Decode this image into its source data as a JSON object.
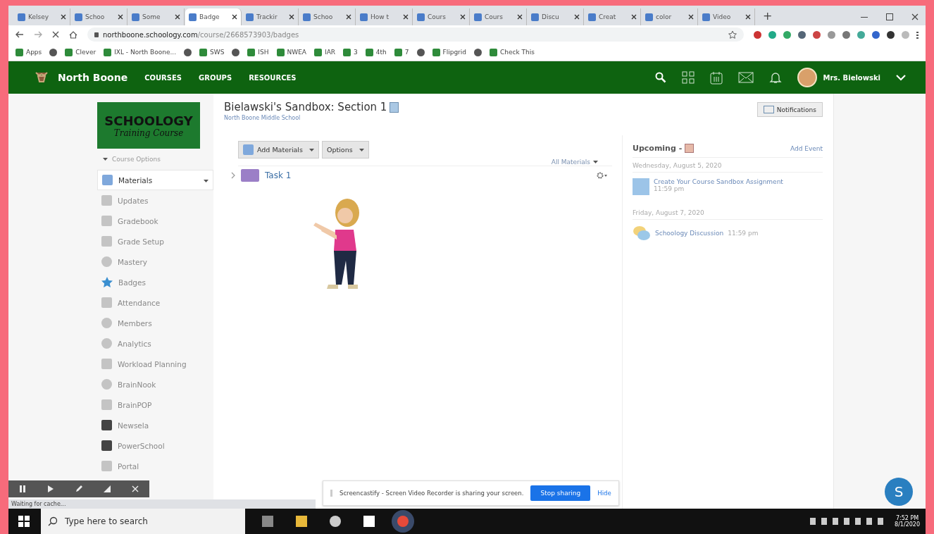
{
  "browser": {
    "tabs": [
      {
        "label": "Kelsey",
        "selected": false
      },
      {
        "label": "Schoo",
        "selected": false
      },
      {
        "label": "Some",
        "selected": false
      },
      {
        "label": "Badge",
        "selected": true
      },
      {
        "label": "Trackir",
        "selected": false
      },
      {
        "label": "Schoo",
        "selected": false
      },
      {
        "label": "How t",
        "selected": false
      },
      {
        "label": "Cours",
        "selected": false
      },
      {
        "label": "Cours",
        "selected": false
      },
      {
        "label": "Discu",
        "selected": false
      },
      {
        "label": "Creat",
        "selected": false
      },
      {
        "label": "color",
        "selected": false
      },
      {
        "label": "Video",
        "selected": false
      }
    ],
    "new_tab": "+",
    "url_host": "northboone.schoology.com",
    "url_path": "/course/2668573903/badges",
    "bookmarks": [
      {
        "kind": "link",
        "label": "Apps"
      },
      {
        "kind": "icon"
      },
      {
        "kind": "link",
        "label": "Clever"
      },
      {
        "kind": "link",
        "label": "IXL - North Boone..."
      },
      {
        "kind": "icon"
      },
      {
        "kind": "link",
        "label": "SWS"
      },
      {
        "kind": "icon"
      },
      {
        "kind": "link",
        "label": "ISH"
      },
      {
        "kind": "link",
        "label": "NWEA"
      },
      {
        "kind": "link",
        "label": "IAR"
      },
      {
        "kind": "link",
        "label": "3"
      },
      {
        "kind": "link",
        "label": "4th"
      },
      {
        "kind": "link",
        "label": "7"
      },
      {
        "kind": "icon"
      },
      {
        "kind": "link",
        "label": "Flipgrid"
      },
      {
        "kind": "icon"
      },
      {
        "kind": "link",
        "label": "Check This"
      }
    ]
  },
  "header": {
    "brand": "North Boone",
    "nav": [
      "COURSES",
      "GROUPS",
      "RESOURCES"
    ],
    "user": "Mrs. Bielowski"
  },
  "course": {
    "logo_title": "SCHOOLOGY",
    "logo_subtitle": "Training Course",
    "options": "Course Options",
    "title": "Bielawski's Sandbox: Section 1",
    "school": "North Boone Middle School",
    "notifications": "Notifications"
  },
  "sidebar": {
    "items": [
      {
        "label": "Materials",
        "kind": "folder",
        "selected": true
      },
      {
        "label": "Updates",
        "kind": "tile",
        "selected": false
      },
      {
        "label": "Gradebook",
        "kind": "tile",
        "selected": false
      },
      {
        "label": "Grade Setup",
        "kind": "tile",
        "selected": false
      },
      {
        "label": "Mastery",
        "kind": "round",
        "selected": false
      },
      {
        "label": "Badges",
        "kind": "star",
        "selected": false
      },
      {
        "label": "Attendance",
        "kind": "tile",
        "selected": false
      },
      {
        "label": "Members",
        "kind": "round",
        "selected": false
      },
      {
        "label": "Analytics",
        "kind": "round",
        "selected": false
      },
      {
        "label": "Workload Planning",
        "kind": "tile",
        "selected": false
      },
      {
        "label": "BrainNook",
        "kind": "round",
        "selected": false
      },
      {
        "label": "BrainPOP",
        "kind": "tile",
        "selected": false
      },
      {
        "label": "Newsela",
        "kind": "dark",
        "selected": false
      },
      {
        "label": "PowerSchool",
        "kind": "dark",
        "selected": false
      },
      {
        "label": "Portal",
        "kind": "tile",
        "selected": false
      }
    ]
  },
  "materials": {
    "add": "Add Materials",
    "options": "Options",
    "filter": "All Materials",
    "items": [
      {
        "title": "Task 1"
      }
    ]
  },
  "upcoming": {
    "title": "Upcoming -",
    "add": "Add Event",
    "days": [
      {
        "date": "Wednesday, August 5, 2020",
        "events": [
          {
            "title": "Create Your Course Sandbox Assignment",
            "time": "11:59 pm",
            "kind": "assignment"
          }
        ]
      },
      {
        "date": "Friday, August 7, 2020",
        "events": [
          {
            "title": "Schoology Discussion",
            "time": "11:59 pm",
            "kind": "discussion"
          }
        ]
      }
    ]
  },
  "share_bar": {
    "message": "Screencastify - Screen Video Recorder is sharing your screen.",
    "stop": "Stop sharing",
    "hide": "Hide"
  },
  "status": "Waiting for cache...",
  "chat_badge": "S",
  "taskbar": {
    "search": "Type here to search",
    "time": "7:52 PM",
    "date": "8/1/2020"
  }
}
